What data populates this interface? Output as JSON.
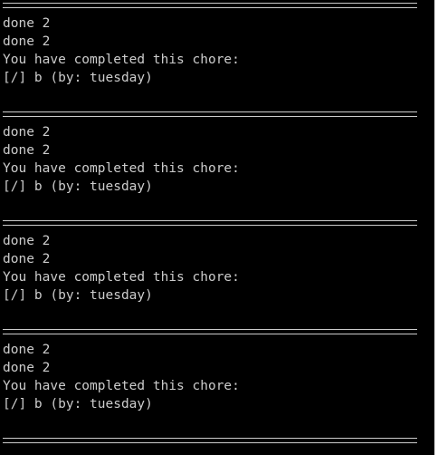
{
  "terminal": {
    "colors": {
      "background": "#000000",
      "text": "#cccccc",
      "scrollbar": "#ffffff"
    },
    "blocks": [
      {
        "separator": "==================================================",
        "line1": "done 2",
        "line2": "done 2",
        "line3": "You have completed this chore:",
        "line4": "[/] b (by: tuesday)"
      },
      {
        "separator": "==================================================",
        "line1": "done 2",
        "line2": "done 2",
        "line3": "You have completed this chore:",
        "line4": "[/] b (by: tuesday)"
      },
      {
        "separator": "==================================================",
        "line1": "done 2",
        "line2": "done 2",
        "line3": "You have completed this chore:",
        "line4": "[/] b (by: tuesday)"
      },
      {
        "separator": "==================================================",
        "line1": "done 2",
        "line2": "done 2",
        "line3": "You have completed this chore:",
        "line4": "[/] b (by: tuesday)"
      }
    ],
    "final_separator": "=================================================="
  }
}
